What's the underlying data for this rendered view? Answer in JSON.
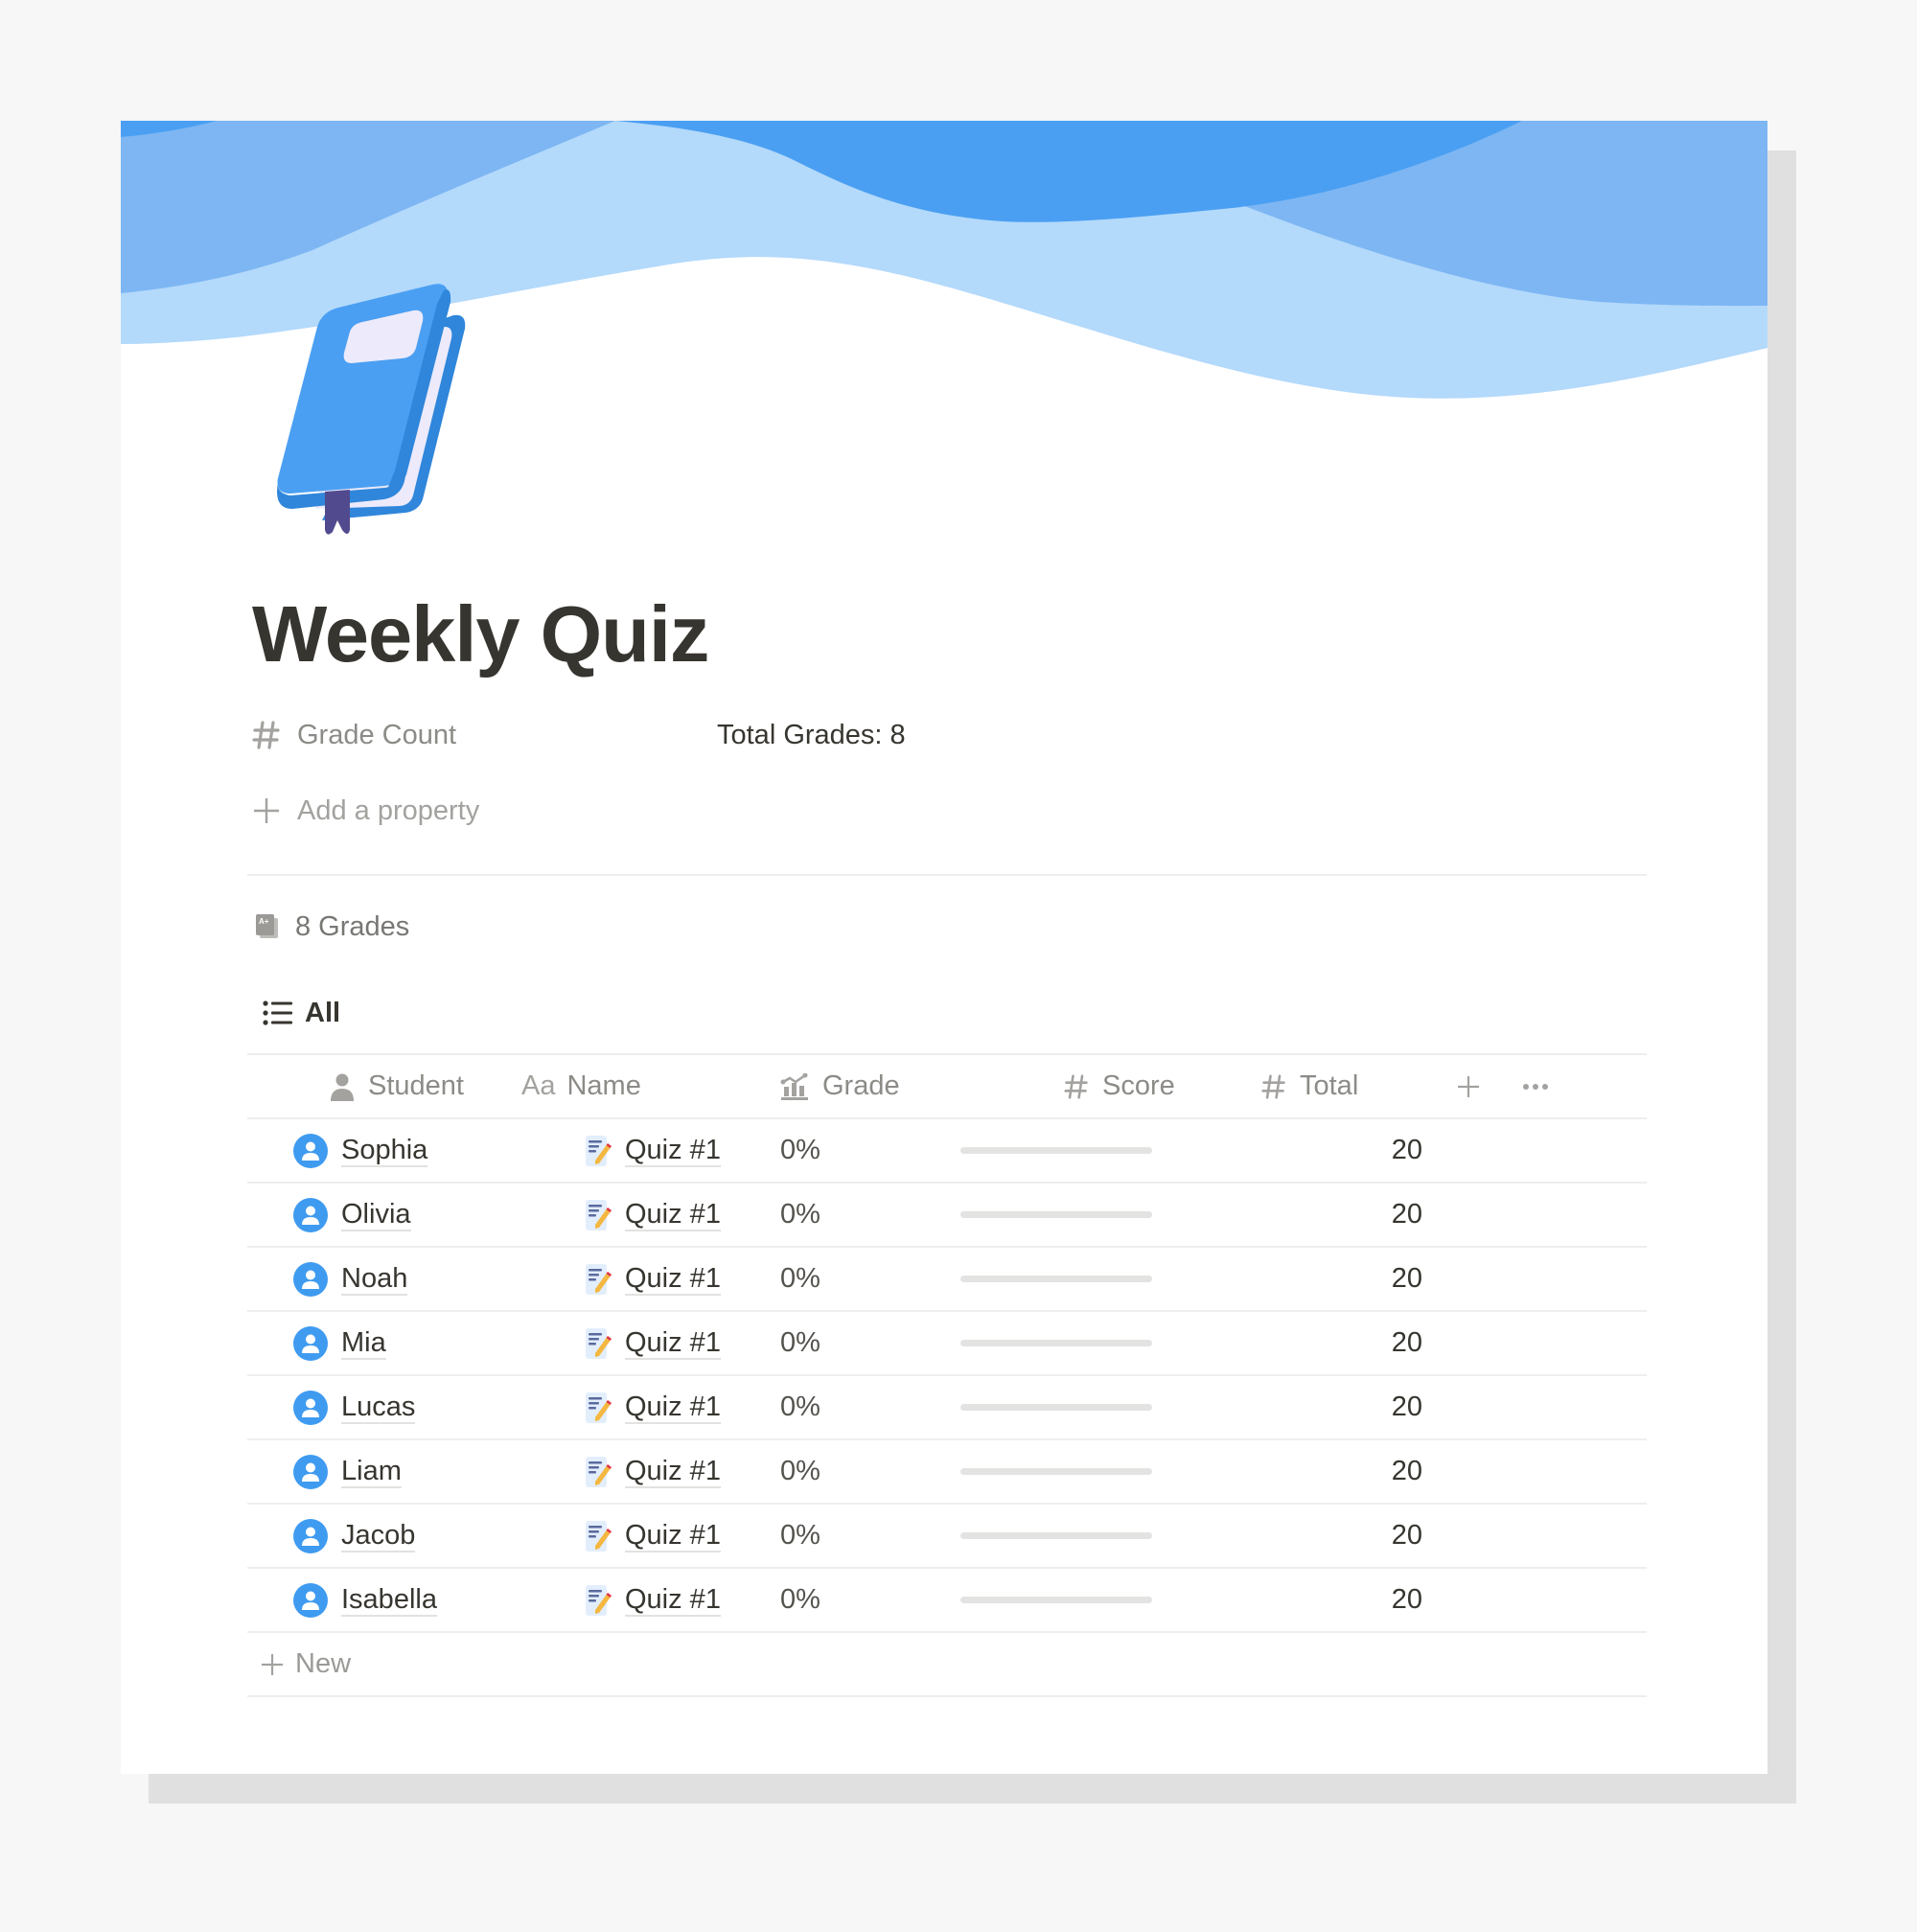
{
  "page": {
    "title": "Weekly Quiz",
    "icon": "book-icon",
    "cover": "blue-waves"
  },
  "properties": [
    {
      "icon": "hash-icon",
      "label": "Grade Count",
      "value": "Total Grades: 8"
    }
  ],
  "add_property_label": "Add a property",
  "database": {
    "icon": "grade-document-icon",
    "title": "8 Grades",
    "views": [
      {
        "icon": "list-icon",
        "label": "All",
        "active": true
      }
    ],
    "columns": [
      {
        "icon": "person-icon",
        "label": "Student"
      },
      {
        "icon": "text-icon",
        "icon_text": "Aa",
        "label": "Name"
      },
      {
        "icon": "chart-icon",
        "label": "Grade"
      },
      {
        "icon": "hash-icon",
        "icon_text": "#",
        "label": "Score"
      },
      {
        "icon": "hash-icon",
        "icon_text": "#",
        "label": "Total"
      }
    ],
    "add_column_icon": "plus-icon",
    "more_icon": "ellipsis-icon",
    "rows": [
      {
        "student": "Sophia",
        "name": "Quiz #1",
        "grade_label": "0%",
        "grade": 0,
        "score": "",
        "total": "20"
      },
      {
        "student": "Olivia",
        "name": "Quiz #1",
        "grade_label": "0%",
        "grade": 0,
        "score": "",
        "total": "20"
      },
      {
        "student": "Noah",
        "name": "Quiz #1",
        "grade_label": "0%",
        "grade": 0,
        "score": "",
        "total": "20"
      },
      {
        "student": "Mia",
        "name": "Quiz #1",
        "grade_label": "0%",
        "grade": 0,
        "score": "",
        "total": "20"
      },
      {
        "student": "Lucas",
        "name": "Quiz #1",
        "grade_label": "0%",
        "grade": 0,
        "score": "",
        "total": "20"
      },
      {
        "student": "Liam",
        "name": "Quiz #1",
        "grade_label": "0%",
        "grade": 0,
        "score": "",
        "total": "20"
      },
      {
        "student": "Jacob",
        "name": "Quiz #1",
        "grade_label": "0%",
        "grade": 0,
        "score": "",
        "total": "20"
      },
      {
        "student": "Isabella",
        "name": "Quiz #1",
        "grade_label": "0%",
        "grade": 0,
        "score": "",
        "total": "20"
      }
    ],
    "new_label": "New"
  },
  "colors": {
    "accent": "#3F9BF0",
    "wave_light": "#B3D9FB",
    "wave_medium": "#7DB6F3",
    "wave_dark": "#4A9FF2",
    "text": "#37352F",
    "muted": "#8C8B87",
    "progress_track": "#E3E3E2"
  }
}
